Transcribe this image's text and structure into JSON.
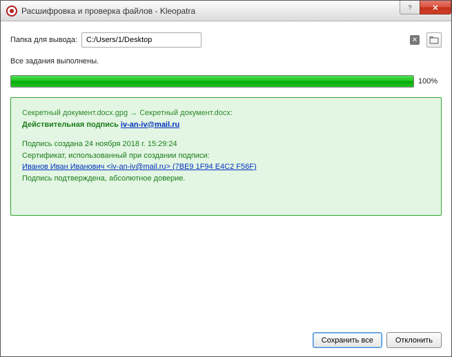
{
  "window": {
    "title": "Расшифровка и проверка файлов - Kleopatra"
  },
  "output": {
    "label": "Папка для вывода:",
    "path": "C:/Users/1/Desktop"
  },
  "status": "Все задания выполнены.",
  "progress": {
    "percent_label": "100%"
  },
  "result": {
    "file_line": "Секретный документ.docx.gpg → Секретный документ.docx:",
    "valid_prefix": "Действительная подпись ",
    "valid_email": "iv-an-iv@mail.ru",
    "sig_created": "Подпись создана 24 ноября 2018 г. 15:29:24",
    "cert_used": "Сертификат, использованный при создании подписи:",
    "cert_link": "Иванов Иван Иванович <iv-an-iv@mail.ru> (7BE9 1F94 E4C2 F56F)",
    "trust": "Подпись подтверждена, абсолютное доверие."
  },
  "buttons": {
    "save_all": "Сохранить все",
    "reject": "Отклонить"
  }
}
